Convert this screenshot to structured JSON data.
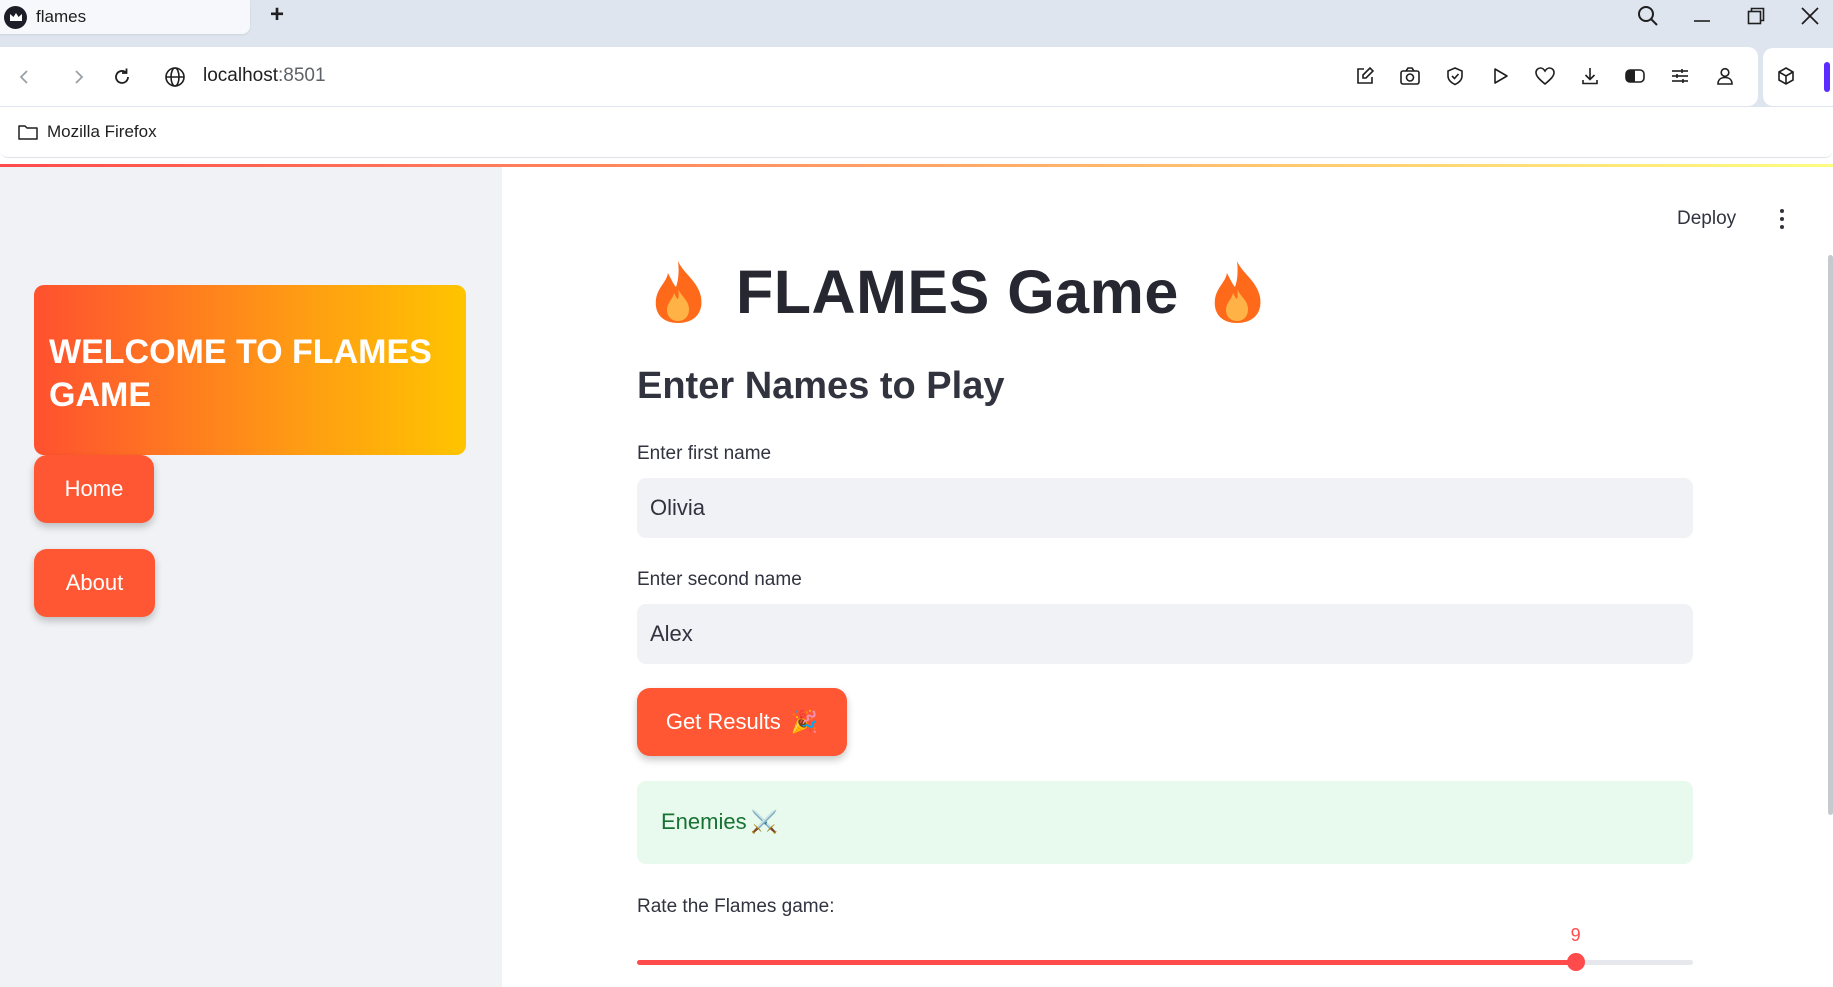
{
  "browser": {
    "tab_title": "flames",
    "new_tab_label": "+",
    "url_host": "localhost",
    "url_port": ":8501",
    "bookmark_folder": "Mozilla Firefox"
  },
  "sidebar": {
    "welcome_text": "WELCOME TO FLAMES GAME",
    "nav": [
      {
        "label": "Home"
      },
      {
        "label": "About"
      }
    ]
  },
  "header": {
    "deploy_label": "Deploy"
  },
  "main": {
    "title": "FLAMES Game",
    "title_icon": "fire-icon",
    "subheading": "Enter Names to Play",
    "first_name": {
      "label": "Enter first name",
      "value": "Olivia"
    },
    "second_name": {
      "label": "Enter second name",
      "value": "Alex"
    },
    "results_button": {
      "label": "Get Results",
      "emoji": "🎉"
    },
    "result": {
      "text": "Enemies",
      "emoji": "⚔️"
    },
    "rating": {
      "label": "Rate the Flames game:",
      "value": 9,
      "min": 1,
      "max": 10
    }
  },
  "colors": {
    "accent": "#ff4b4b",
    "button": "#ff5733",
    "success_bg": "#e8f9ee",
    "success_text": "#177233"
  }
}
